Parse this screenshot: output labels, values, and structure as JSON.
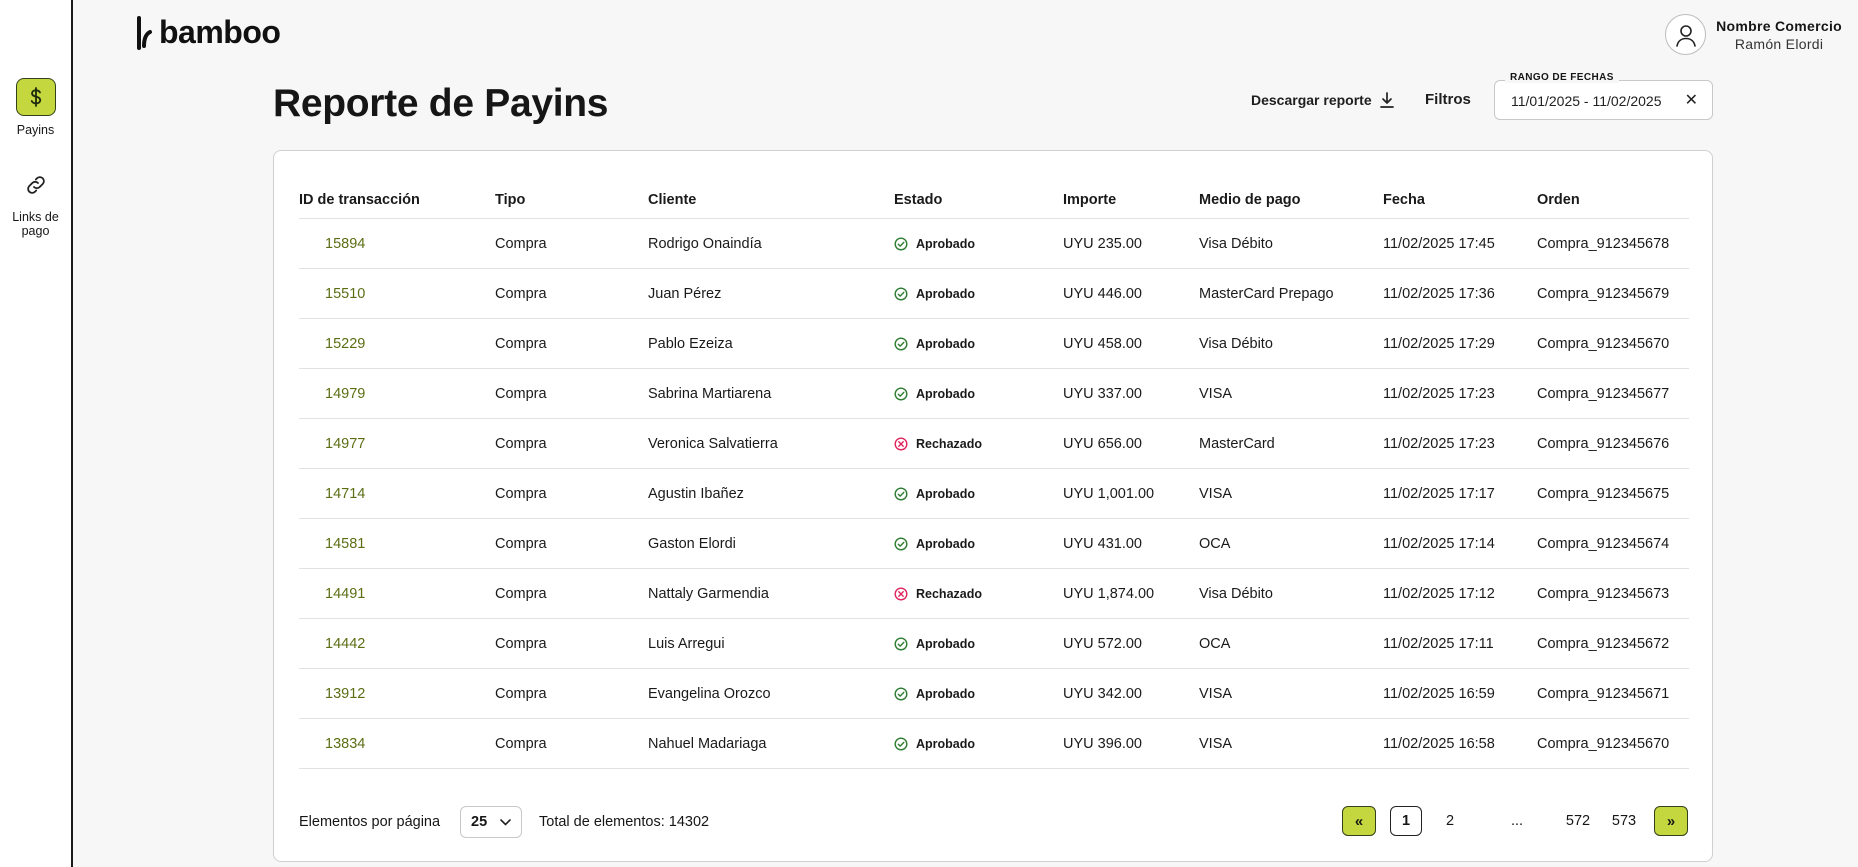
{
  "sidebar": {
    "items": [
      {
        "label": "Payins",
        "icon": "dollar-icon",
        "active": true
      },
      {
        "label": "Links de pago",
        "icon": "link-icon",
        "active": false
      }
    ]
  },
  "header": {
    "logo_text": "bamboo",
    "user_line1": "Nombre Comercio",
    "user_line2": "Ramón Elordi"
  },
  "page": {
    "title": "Reporte de Payins",
    "download_label": "Descargar reporte",
    "filters_label": "Filtros",
    "date_range": {
      "legend": "RANGO DE FECHAS",
      "value": "11/01/2025 - 11/02/2025"
    }
  },
  "table": {
    "headers": [
      "ID de transacción",
      "Tipo",
      "Cliente",
      "Estado",
      "Importe",
      "Medio de pago",
      "Fecha",
      "Orden"
    ],
    "rows": [
      {
        "id": "15894",
        "tipo": "Compra",
        "cliente": "Rodrigo Onaindía",
        "estado": "Aprobado",
        "importe": "UYU 235.00",
        "medio": "Visa Débito",
        "fecha": "11/02/2025 17:45",
        "orden": "Compra_912345678"
      },
      {
        "id": "15510",
        "tipo": "Compra",
        "cliente": "Juan Pérez",
        "estado": "Aprobado",
        "importe": "UYU 446.00",
        "medio": "MasterCard Prepago",
        "fecha": "11/02/2025 17:36",
        "orden": "Compra_912345679"
      },
      {
        "id": "15229",
        "tipo": "Compra",
        "cliente": "Pablo Ezeiza",
        "estado": "Aprobado",
        "importe": "UYU 458.00",
        "medio": "Visa Débito",
        "fecha": "11/02/2025 17:29",
        "orden": "Compra_912345670"
      },
      {
        "id": "14979",
        "tipo": "Compra",
        "cliente": "Sabrina Martiarena",
        "estado": "Aprobado",
        "importe": "UYU 337.00",
        "medio": "VISA",
        "fecha": "11/02/2025 17:23",
        "orden": "Compra_912345677"
      },
      {
        "id": "14977",
        "tipo": "Compra",
        "cliente": "Veronica Salvatierra",
        "estado": "Rechazado",
        "importe": "UYU 656.00",
        "medio": "MasterCard",
        "fecha": "11/02/2025 17:23",
        "orden": "Compra_912345676"
      },
      {
        "id": "14714",
        "tipo": "Compra",
        "cliente": "Agustin Ibañez",
        "estado": "Aprobado",
        "importe": "UYU 1,001.00",
        "medio": "VISA",
        "fecha": "11/02/2025 17:17",
        "orden": "Compra_912345675"
      },
      {
        "id": "14581",
        "tipo": "Compra",
        "cliente": "Gaston Elordi",
        "estado": "Aprobado",
        "importe": "UYU 431.00",
        "medio": "OCA",
        "fecha": "11/02/2025 17:14",
        "orden": "Compra_912345674"
      },
      {
        "id": "14491",
        "tipo": "Compra",
        "cliente": "Nattaly Garmendia",
        "estado": "Rechazado",
        "importe": "UYU 1,874.00",
        "medio": "Visa Débito",
        "fecha": "11/02/2025 17:12",
        "orden": "Compra_912345673"
      },
      {
        "id": "14442",
        "tipo": "Compra",
        "cliente": "Luis Arregui",
        "estado": "Aprobado",
        "importe": "UYU 572.00",
        "medio": "OCA",
        "fecha": "11/02/2025 17:11",
        "orden": "Compra_912345672"
      },
      {
        "id": "13912",
        "tipo": "Compra",
        "cliente": "Evangelina Orozco",
        "estado": "Aprobado",
        "importe": "UYU 342.00",
        "medio": "VISA",
        "fecha": "11/02/2025 16:59",
        "orden": "Compra_912345671"
      },
      {
        "id": "13834",
        "tipo": "Compra",
        "cliente": "Nahuel Madariaga",
        "estado": "Aprobado",
        "importe": "UYU 396.00",
        "medio": "VISA",
        "fecha": "11/02/2025 16:58",
        "orden": "Compra_912345670"
      }
    ]
  },
  "pagination": {
    "per_page_label": "Elementos por página",
    "per_page_value": "25",
    "total_label": "Total de elementos: 14302",
    "first_label": "«",
    "last_label": "»",
    "pages": [
      "1",
      "2",
      "...",
      "572",
      "573"
    ],
    "current_page": "1"
  },
  "colors": {
    "accent": "#c4d73f",
    "id_link": "#5b6e14",
    "approved": "#2e7d32",
    "rejected": "#e0245e"
  }
}
